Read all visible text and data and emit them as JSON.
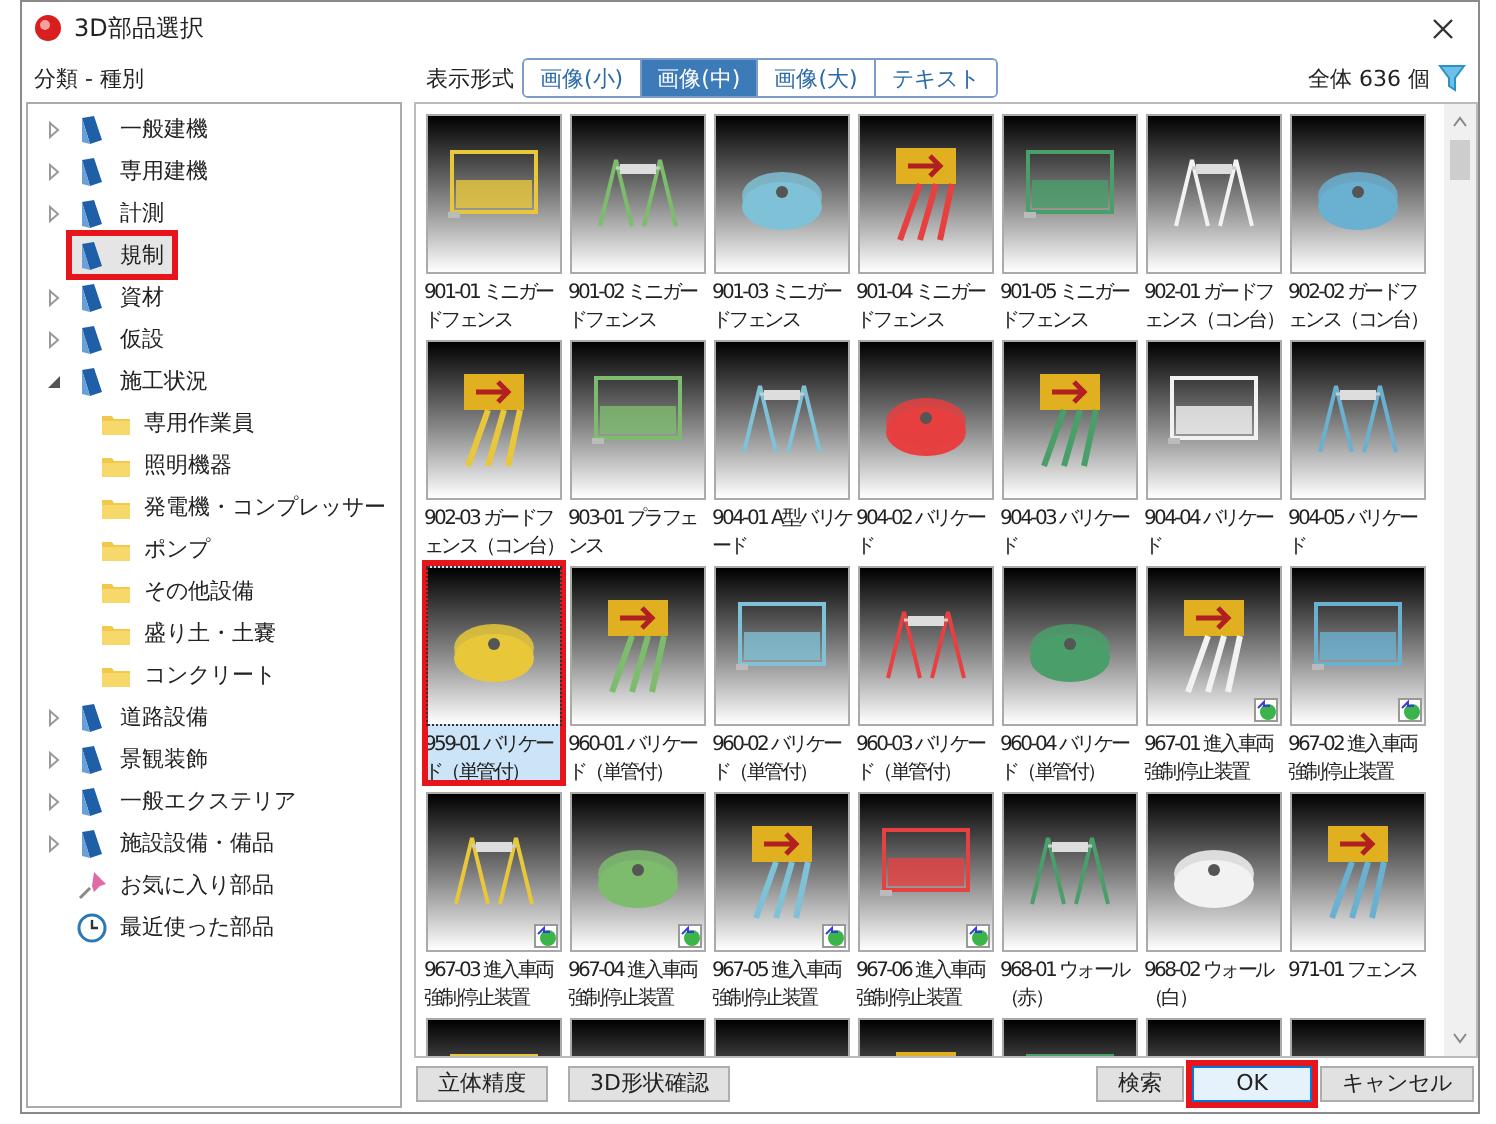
{
  "window": {
    "title": "3D部品選択"
  },
  "category_header": "分類 - 種別",
  "view": {
    "label": "表示形式",
    "tabs": [
      {
        "label": "画像(小)",
        "selected": false
      },
      {
        "label": "画像(中)",
        "selected": true
      },
      {
        "label": "画像(大)",
        "selected": false
      },
      {
        "label": "テキスト",
        "selected": false
      }
    ]
  },
  "total": "全体 636 個",
  "tree": [
    {
      "label": "一般建機",
      "kind": "category",
      "expandable": true,
      "expanded": false,
      "selected": false,
      "highlighted": false
    },
    {
      "label": "専用建機",
      "kind": "category",
      "expandable": true,
      "expanded": false,
      "selected": false,
      "highlighted": false
    },
    {
      "label": "計測",
      "kind": "category",
      "expandable": true,
      "expanded": false,
      "selected": false,
      "highlighted": false
    },
    {
      "label": "規制",
      "kind": "category",
      "expandable": false,
      "selected": true,
      "highlighted": true
    },
    {
      "label": "資材",
      "kind": "category",
      "expandable": true,
      "expanded": false,
      "selected": false,
      "highlighted": false
    },
    {
      "label": "仮設",
      "kind": "category",
      "expandable": true,
      "expanded": false,
      "selected": false,
      "highlighted": false
    },
    {
      "label": "施工状況",
      "kind": "category",
      "expandable": true,
      "expanded": true,
      "selected": false,
      "highlighted": false,
      "children": [
        {
          "label": "専用作業員",
          "kind": "folder",
          "expandable": false,
          "selected": false,
          "highlighted": false
        },
        {
          "label": "照明機器",
          "kind": "folder",
          "expandable": false,
          "selected": false,
          "highlighted": false
        },
        {
          "label": "発電機・コンプレッサー",
          "kind": "folder",
          "expandable": false,
          "selected": false,
          "highlighted": false
        },
        {
          "label": "ポンプ",
          "kind": "folder",
          "expandable": false,
          "selected": false,
          "highlighted": false
        },
        {
          "label": "その他設備",
          "kind": "folder",
          "expandable": false,
          "selected": false,
          "highlighted": false
        },
        {
          "label": "盛り土・土嚢",
          "kind": "folder",
          "expandable": false,
          "selected": false,
          "highlighted": false
        },
        {
          "label": "コンクリート",
          "kind": "folder",
          "expandable": false,
          "selected": false,
          "highlighted": false
        }
      ]
    },
    {
      "label": "道路設備",
      "kind": "category",
      "expandable": true,
      "expanded": false,
      "selected": false,
      "highlighted": false
    },
    {
      "label": "景観装飾",
      "kind": "category",
      "expandable": true,
      "expanded": false,
      "selected": false,
      "highlighted": false
    },
    {
      "label": "一般エクステリア",
      "kind": "category",
      "expandable": true,
      "expanded": false,
      "selected": false,
      "highlighted": false
    },
    {
      "label": "施設設備・備品",
      "kind": "category",
      "expandable": true,
      "expanded": false,
      "selected": false,
      "highlighted": false
    },
    {
      "label": "お気に入り部品",
      "kind": "favorite",
      "expandable": false,
      "selected": false,
      "highlighted": false
    },
    {
      "label": "最近使った部品",
      "kind": "recent",
      "expandable": false,
      "selected": false,
      "highlighted": false
    }
  ],
  "parts": [
    {
      "kind": "part",
      "label": "901-01 ミニガードフェンス",
      "selected": false,
      "highlighted": false,
      "badge": false
    },
    {
      "kind": "part",
      "label": "901-02 ミニガードフェンス",
      "selected": false,
      "highlighted": false,
      "badge": false
    },
    {
      "kind": "part",
      "label": "901-03 ミニガードフェンス",
      "selected": false,
      "highlighted": false,
      "badge": false
    },
    {
      "kind": "part",
      "label": "901-04 ミニガードフェンス",
      "selected": false,
      "highlighted": false,
      "badge": false
    },
    {
      "kind": "part",
      "label": "901-05 ミニガードフェンス",
      "selected": false,
      "highlighted": false,
      "badge": false
    },
    {
      "kind": "part",
      "label": "902-01 ガードフェンス（コン台）",
      "selected": false,
      "highlighted": false,
      "badge": false
    },
    {
      "kind": "part",
      "label": "902-02 ガードフェンス（コン台）",
      "selected": false,
      "highlighted": false,
      "badge": false
    },
    {
      "kind": "part",
      "label": "902-03 ガードフェンス（コン台）",
      "selected": false,
      "highlighted": false,
      "badge": false
    },
    {
      "kind": "part",
      "label": "903-01 プラフェンス",
      "selected": false,
      "highlighted": false,
      "badge": false
    },
    {
      "kind": "part",
      "label": "904-01 A型バリケード",
      "selected": false,
      "highlighted": false,
      "badge": false
    },
    {
      "kind": "part",
      "label": "904-02 バリケード",
      "selected": false,
      "highlighted": false,
      "badge": false
    },
    {
      "kind": "part",
      "label": "904-03 バリケード",
      "selected": false,
      "highlighted": false,
      "badge": false
    },
    {
      "kind": "part",
      "label": "904-04 バリケード",
      "selected": false,
      "highlighted": false,
      "badge": false
    },
    {
      "kind": "part",
      "label": "904-05 バリケード",
      "selected": false,
      "highlighted": false,
      "badge": false
    },
    {
      "kind": "part",
      "label": "959-01 バリケード（単管付）",
      "selected": true,
      "highlighted": true,
      "badge": false
    },
    {
      "kind": "part",
      "label": "960-01 バリケード（単管付）",
      "selected": false,
      "highlighted": false,
      "badge": false
    },
    {
      "kind": "part",
      "label": "960-02 バリケード（単管付）",
      "selected": false,
      "highlighted": false,
      "badge": false
    },
    {
      "kind": "part",
      "label": "960-03 バリケード（単管付）",
      "selected": false,
      "highlighted": false,
      "badge": false
    },
    {
      "kind": "part",
      "label": "960-04 バリケード（単管付）",
      "selected": false,
      "highlighted": false,
      "badge": false
    },
    {
      "kind": "part",
      "label": "967-01 進入車両強制停止装置",
      "selected": false,
      "highlighted": false,
      "badge": true
    },
    {
      "kind": "part",
      "label": "967-02 進入車両強制停止装置",
      "selected": false,
      "highlighted": false,
      "badge": true
    },
    {
      "kind": "part",
      "label": "967-03 進入車両強制停止装置",
      "selected": false,
      "highlighted": false,
      "badge": true
    },
    {
      "kind": "part",
      "label": "967-04 進入車両強制停止装置",
      "selected": false,
      "highlighted": false,
      "badge": true
    },
    {
      "kind": "part",
      "label": "967-05 進入車両強制停止装置",
      "selected": false,
      "highlighted": false,
      "badge": true
    },
    {
      "kind": "part",
      "label": "967-06 進入車両強制停止装置",
      "selected": false,
      "highlighted": false,
      "badge": true
    },
    {
      "kind": "part",
      "label": "968-01 ウォール（赤）",
      "selected": false,
      "highlighted": false,
      "badge": false
    },
    {
      "kind": "part",
      "label": "968-02 ウォール（白）",
      "selected": false,
      "highlighted": false,
      "badge": false
    },
    {
      "kind": "part",
      "label": "971-01 フェンス",
      "selected": false,
      "highlighted": false,
      "badge": false
    },
    {
      "kind": "picture"
    },
    {
      "kind": "picture"
    },
    {
      "kind": "picture"
    },
    {
      "kind": "picture"
    },
    {
      "kind": "picture"
    },
    {
      "kind": "picture"
    },
    {
      "kind": "picture"
    }
  ],
  "buttons_left": [
    {
      "label": "立体精度",
      "highlighted": false
    },
    {
      "label": "3D形状確認",
      "highlighted": false
    }
  ],
  "buttons_right": [
    {
      "label": "検索",
      "highlighted": false
    },
    {
      "label": "OK",
      "highlighted": true
    },
    {
      "label": "キャンセル",
      "highlighted": false
    }
  ]
}
